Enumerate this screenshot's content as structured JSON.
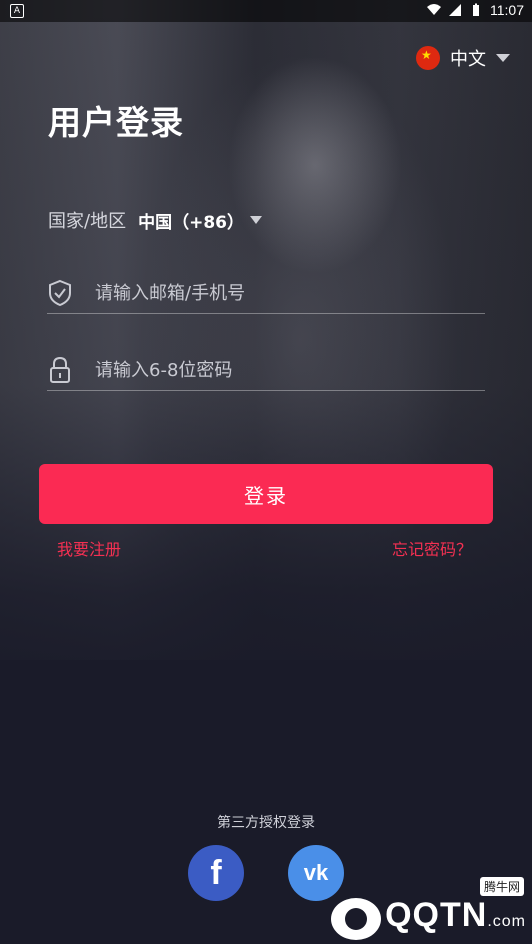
{
  "status_bar": {
    "time": "11:07",
    "notif_icon": "A"
  },
  "language": {
    "label": "中文",
    "flag_icon": "china-flag-icon"
  },
  "title": "用户登录",
  "region": {
    "label": "国家/地区",
    "value": "中国（+86）"
  },
  "email_field": {
    "placeholder": "请输入邮箱/手机号",
    "icon": "shield-check-icon"
  },
  "password_field": {
    "placeholder": "请输入6-8位密码",
    "icon": "lock-icon"
  },
  "login_button": "登录",
  "register_link": "我要注册",
  "forgot_link": "忘记密码？",
  "third_party": {
    "title": "第三方授权登录",
    "facebook": "f",
    "vk": "vk"
  },
  "watermark": {
    "text": "QQTN",
    "suffix": ".com",
    "badge": "腾牛网"
  },
  "colors": {
    "accent": "#fb2a53",
    "link": "#f43052",
    "background": "#1a1b29",
    "facebook": "#3b5cc4",
    "vk": "#4a8fe8"
  }
}
